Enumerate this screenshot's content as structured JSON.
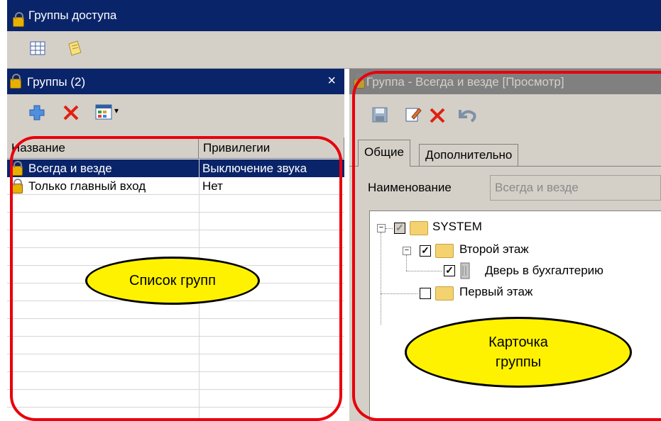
{
  "window": {
    "title": "Группы доступа"
  },
  "groups_panel": {
    "title": "Группы (2)",
    "columns": [
      "Название",
      "Привилегии"
    ],
    "rows": [
      {
        "name": "Всегда и везде",
        "privileges": "Выключение звука"
      },
      {
        "name": "Только главный вход",
        "privileges": "Нет"
      }
    ]
  },
  "card_panel": {
    "title": "Группа - Всегда и везде [Просмотр]",
    "tabs": [
      "Общие",
      "Дополнительно"
    ],
    "name_label": "Наименование",
    "name_value": "Всегда и везде",
    "tree": [
      {
        "label": "SYSTEM",
        "checked": "grey"
      },
      {
        "label": "Второй этаж",
        "checked": true
      },
      {
        "label": "Дверь в бухгалтерию",
        "checked": true
      },
      {
        "label": "Первый этаж",
        "checked": false
      }
    ]
  },
  "callouts": {
    "groups_list": "Список групп",
    "group_card_line1": "Карточка",
    "group_card_line2": "группы"
  },
  "colors": {
    "titlebar": "#0a246a",
    "callout": "#fff200",
    "frame": "#e8000b"
  }
}
